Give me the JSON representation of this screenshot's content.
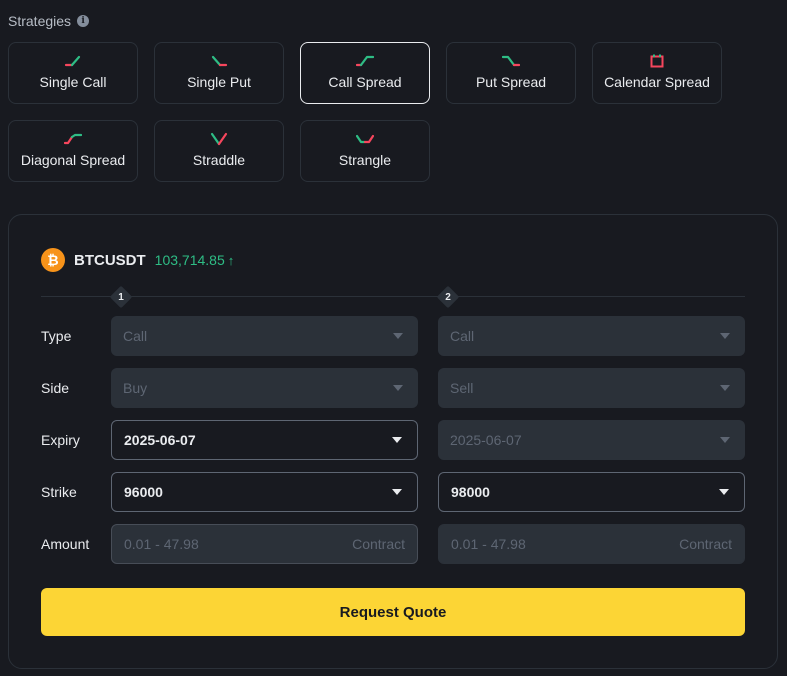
{
  "header": {
    "title": "Strategies"
  },
  "strategies": [
    {
      "label": "Single Call",
      "icon": "single-call-icon"
    },
    {
      "label": "Single Put",
      "icon": "single-put-icon"
    },
    {
      "label": "Call Spread",
      "icon": "call-spread-icon",
      "active": true
    },
    {
      "label": "Put Spread",
      "icon": "put-spread-icon"
    },
    {
      "label": "Calendar Spread",
      "icon": "calendar-spread-icon"
    },
    {
      "label": "Diagonal Spread",
      "icon": "diagonal-spread-icon"
    },
    {
      "label": "Straddle",
      "icon": "straddle-icon"
    },
    {
      "label": "Strangle",
      "icon": "strangle-icon"
    }
  ],
  "ticker": {
    "icon_glyph": "₿",
    "symbol": "BTCUSDT",
    "price": "103,714.85",
    "direction": "↑"
  },
  "legs": [
    "1",
    "2"
  ],
  "labels": {
    "type": "Type",
    "side": "Side",
    "expiry": "Expiry",
    "strike": "Strike",
    "amount": "Amount"
  },
  "leg1": {
    "type": "Call",
    "side": "Buy",
    "expiry": "2025-06-07",
    "strike": "96000",
    "amount_placeholder": "0.01 - 47.98",
    "amount_unit": "Contract"
  },
  "leg2": {
    "type": "Call",
    "side": "Sell",
    "expiry": "2025-06-07",
    "strike": "98000",
    "amount_placeholder": "0.01 - 47.98",
    "amount_unit": "Contract"
  },
  "actions": {
    "request_quote": "Request Quote"
  },
  "colors": {
    "accent": "#fcd535",
    "up": "#2ebd85",
    "down": "#f6465d",
    "background": "#181a20"
  }
}
